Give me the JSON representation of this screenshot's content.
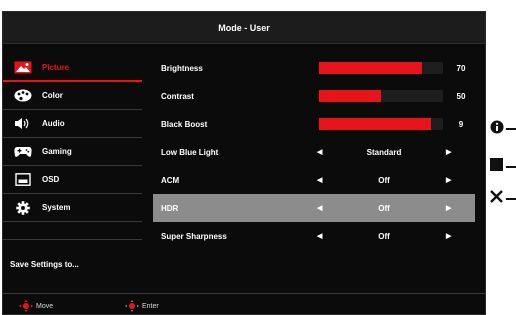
{
  "title": "Mode - User",
  "sidebar": {
    "items": [
      {
        "label": "Picture",
        "icon": "picture-icon",
        "active": true
      },
      {
        "label": "Color",
        "icon": "palette-icon",
        "active": false
      },
      {
        "label": "Audio",
        "icon": "speaker-icon",
        "active": false
      },
      {
        "label": "Gaming",
        "icon": "gamepad-icon",
        "active": false
      },
      {
        "label": "OSD",
        "icon": "osd-icon",
        "active": false
      },
      {
        "label": "System",
        "icon": "gear-icon",
        "active": false
      }
    ],
    "save_label": "Save Settings to..."
  },
  "settings": {
    "brightness": {
      "label": "Brightness",
      "value": "70",
      "level": 0.83
    },
    "contrast": {
      "label": "Contrast",
      "value": "50",
      "level": 0.5
    },
    "black_boost": {
      "label": "Black Boost",
      "value": "9",
      "level": 0.9
    },
    "low_blue_light": {
      "label": "Low Blue Light",
      "value": "Standard"
    },
    "acm": {
      "label": "ACM",
      "value": "Off"
    },
    "hdr": {
      "label": "HDR",
      "value": "Off",
      "selected": true
    },
    "super_sharpness": {
      "label": "Super Sharpness",
      "value": "Off"
    }
  },
  "footer": {
    "move_label": "Move",
    "enter_label": "Enter"
  },
  "hardware_buttons": [
    "info-icon",
    "square-icon",
    "close-icon"
  ],
  "colors": {
    "accent": "#e8141c",
    "background": "#0b0b0b",
    "selected_row": "#8c8c8c"
  }
}
